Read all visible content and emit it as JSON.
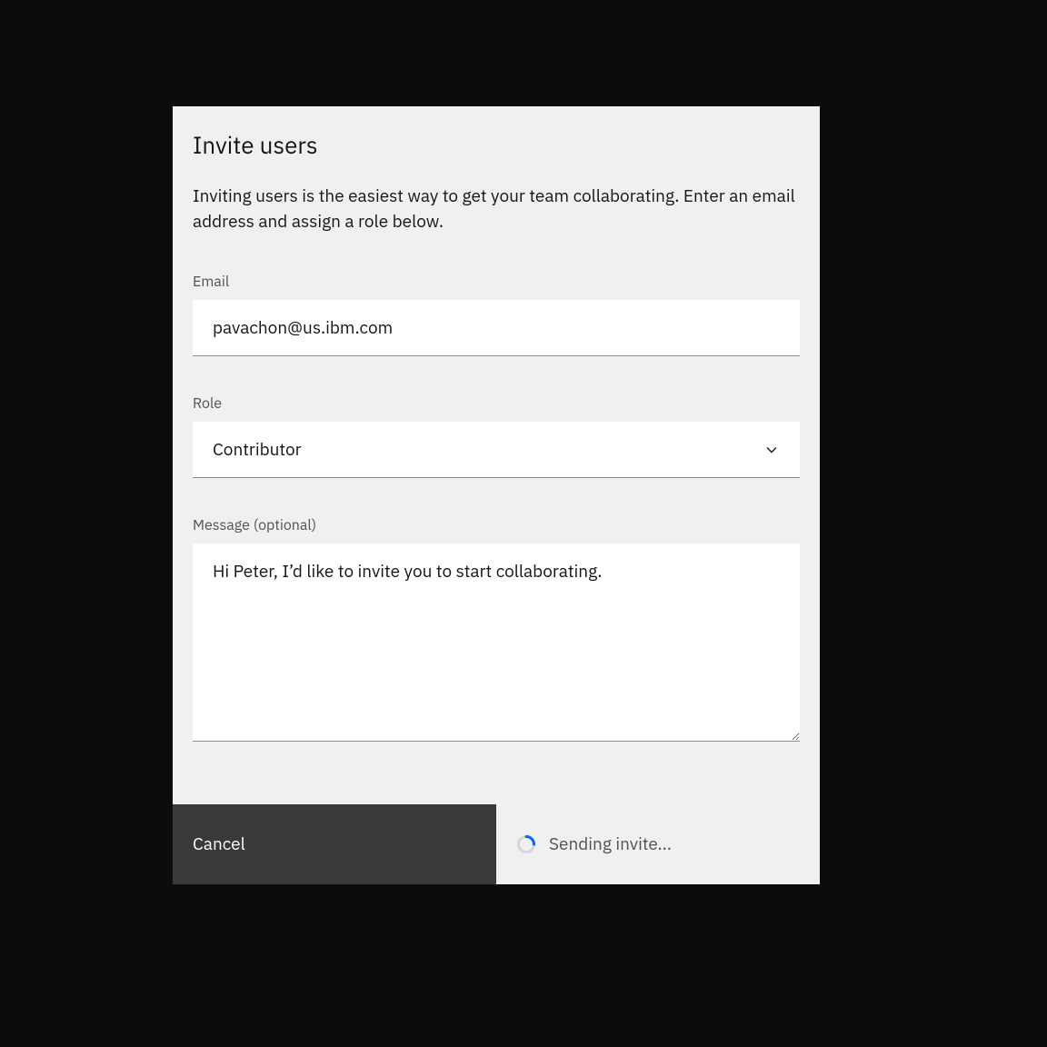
{
  "modal": {
    "title": "Invite users",
    "description": "Inviting users is the easiest way to get your team collaborating. Enter an email address and assign a role below."
  },
  "form": {
    "email": {
      "label": "Email",
      "value": "pavachon@us.ibm.com"
    },
    "role": {
      "label": "Role",
      "selected": "Contributor"
    },
    "message": {
      "label": "Message (optional)",
      "value": "Hi Peter, I’d like to invite you to start collaborating."
    }
  },
  "footer": {
    "cancel_label": "Cancel",
    "submit_label": "Sending invite..."
  }
}
